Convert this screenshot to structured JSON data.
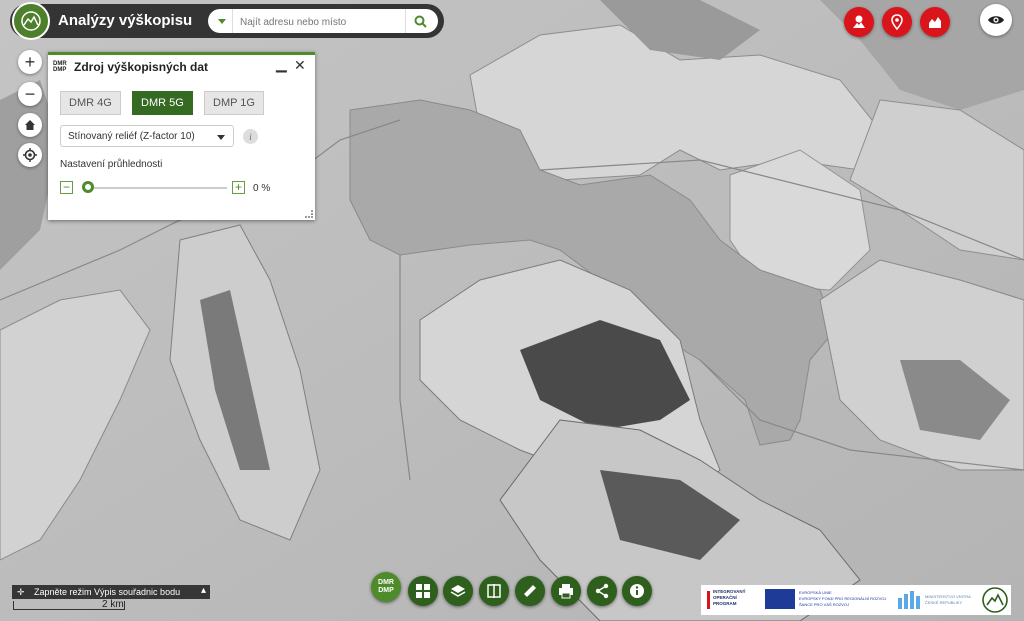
{
  "app": {
    "title": "Analýzy výškopisu"
  },
  "search": {
    "placeholder": "Najít adresu nebo místo"
  },
  "map_controls": {
    "zoom_in": "+",
    "zoom_out": "−"
  },
  "panel": {
    "badge_line1": "DMR",
    "badge_line2": "DMP",
    "title": "Zdroj výškopisných dat",
    "sources": [
      "DMR 4G",
      "DMR 5G",
      "DMP 1G"
    ],
    "active_source": "DMR 5G",
    "relief_select": "Stínovaný reliéf (Z-factor 10)",
    "opacity_label": "Nastavení průhlednosti",
    "opacity_value": "0 %",
    "opacity_fraction": 0
  },
  "coord_bar": {
    "label": "Zapněte režim Výpis souřadnic bodu"
  },
  "scale": {
    "label": "2 km"
  },
  "toolbar": {
    "dmr_line1": "DMR",
    "dmr_line2": "DMP"
  },
  "logos": {
    "op_line1": "INTEGROVANÝ",
    "op_line2": "OPERAČNÍ",
    "op_line3": "PROGRAM",
    "eu_line1": "EVROPSKÁ UNIE",
    "eu_line2": "EVROPSKÝ FOND PRO REGIONÁLNÍ ROZVOJ",
    "eu_line3": "ŠANCE PRO VÁŠ ROZVOJ",
    "mv_line1": "MINISTERSTVO VNITRA",
    "mv_line2": "ČESKÉ REPUBLIKY"
  },
  "colors": {
    "brand_green": "#4f8a2b",
    "dark_green": "#2f5f1c",
    "alert_red": "#d9141b"
  }
}
